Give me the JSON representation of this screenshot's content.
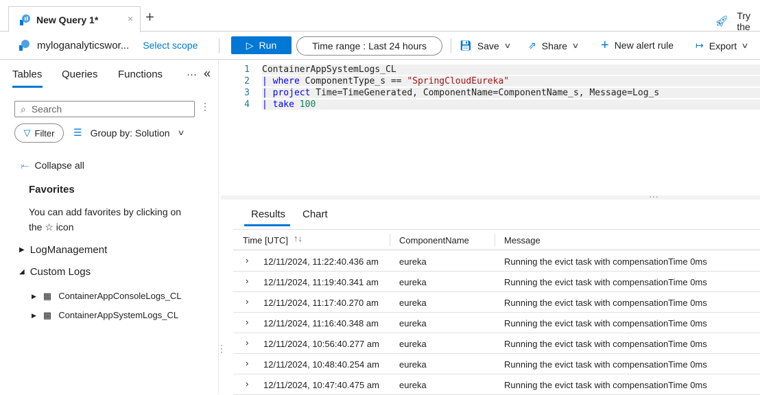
{
  "tab": {
    "title": "New Query 1*",
    "close": "×",
    "new": "+"
  },
  "try": "Try the",
  "workspace": {
    "name": "myloganalyticswor...",
    "select_scope": "Select scope"
  },
  "toolbar": {
    "run": "Run",
    "time_label": "Time range :",
    "time_value": "Last 24 hours",
    "save": "Save",
    "share": "Share",
    "new_alert": "New alert rule",
    "export": "Export"
  },
  "left": {
    "tabs": [
      "Tables",
      "Queries",
      "Functions"
    ],
    "more": "···",
    "collapse": "«",
    "search_placeholder": "Search",
    "filter": "Filter",
    "group_by": "Group by: Solution",
    "collapse_all": "Collapse all",
    "favorites": "Favorites",
    "fav_hint1": "You can add favorites by clicking on",
    "fav_hint2": "the ☆ icon",
    "groups": [
      "LogManagement",
      "Custom Logs"
    ],
    "tables": [
      "ContainerAppConsoleLogs_CL",
      "ContainerAppSystemLogs_CL"
    ]
  },
  "editor": {
    "lines": [
      {
        "n": "1",
        "parts": [
          {
            "t": "ContainerAppSystemLogs_CL",
            "c": "#222"
          }
        ]
      },
      {
        "n": "2",
        "parts": [
          {
            "t": "| ",
            "c": "#0000ff"
          },
          {
            "t": "where",
            "c": "#0000ff"
          },
          {
            "t": " ComponentType_s == ",
            "c": "#222"
          },
          {
            "t": "\"SpringCloudEureka\"",
            "c": "#a31515"
          }
        ]
      },
      {
        "n": "3",
        "parts": [
          {
            "t": "| ",
            "c": "#0000ff"
          },
          {
            "t": "project",
            "c": "#0000ff"
          },
          {
            "t": " Time=TimeGenerated, ComponentName=ComponentName_s, Message=Log_s",
            "c": "#222"
          }
        ]
      },
      {
        "n": "4",
        "parts": [
          {
            "t": "| ",
            "c": "#0000ff"
          },
          {
            "t": "take",
            "c": "#0000ff"
          },
          {
            "t": " ",
            "c": "#222"
          },
          {
            "t": "100",
            "c": "#098658"
          }
        ]
      }
    ]
  },
  "results": {
    "tabs": [
      "Results",
      "Chart"
    ],
    "columns": [
      "Time [UTC]",
      "ComponentName",
      "Message"
    ],
    "sort_icon": "↑↓",
    "rows": [
      [
        "12/11/2024, 11:22:40.436 am",
        "eureka",
        "Running the evict task with compensationTime 0ms"
      ],
      [
        "12/11/2024, 11:19:40.341 am",
        "eureka",
        "Running the evict task with compensationTime 0ms"
      ],
      [
        "12/11/2024, 11:17:40.270 am",
        "eureka",
        "Running the evict task with compensationTime 0ms"
      ],
      [
        "12/11/2024, 11:16:40.348 am",
        "eureka",
        "Running the evict task with compensationTime 0ms"
      ],
      [
        "12/11/2024, 10:56:40.277 am",
        "eureka",
        "Running the evict task with compensationTime 0ms"
      ],
      [
        "12/11/2024, 10:48:40.254 am",
        "eureka",
        "Running the evict task with compensationTime 0ms"
      ],
      [
        "12/11/2024, 10:47:40.475 am",
        "eureka",
        "Running the evict task with compensationTime 0ms"
      ]
    ]
  }
}
